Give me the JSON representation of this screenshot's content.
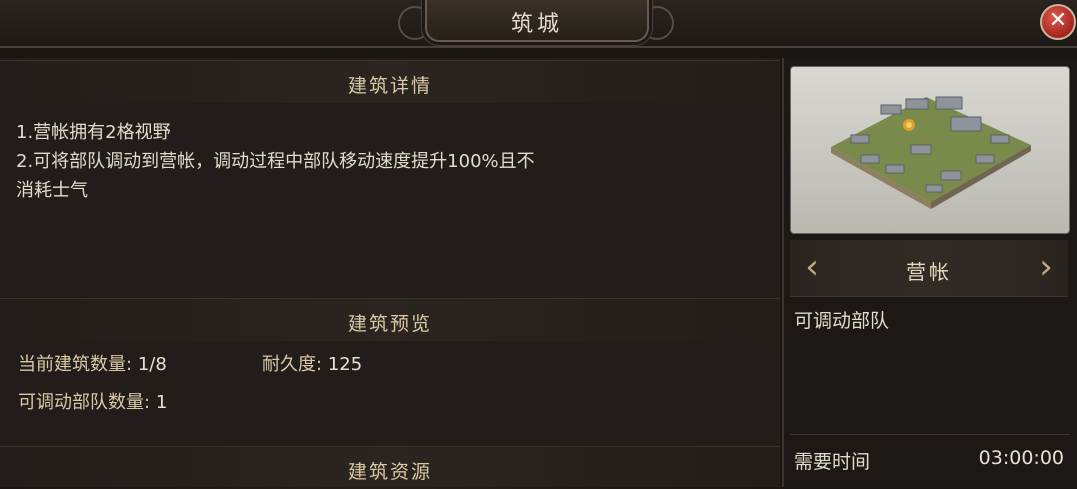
{
  "window": {
    "title": "筑城"
  },
  "close_symbol": "✕",
  "details": {
    "header": "建筑详情",
    "lines": [
      "1.营帐拥有2格视野",
      "2.可将部队调动到营帐，调动过程中部队移动速度提升100%且不",
      "消耗士气"
    ]
  },
  "preview_section": {
    "header": "建筑预览",
    "count_label": "当前建筑数量:",
    "count_value": "1/8",
    "durability_label": "耐久度:",
    "durability_value": "125",
    "troops_label": "可调动部队数量:",
    "troops_value": "1"
  },
  "resources": {
    "header": "建筑资源"
  },
  "side": {
    "building_name": "营帐",
    "prev_icon": "‹",
    "next_icon": "›",
    "troop_label": "可调动部队",
    "time_label": "需要时间",
    "time_value": "03:00:00"
  }
}
